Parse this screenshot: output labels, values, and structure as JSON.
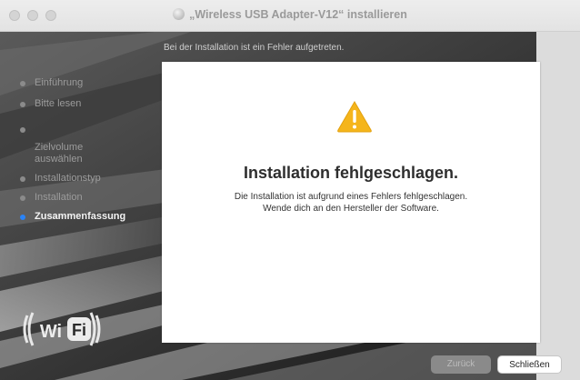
{
  "window": {
    "title": "„Wireless USB Adapter-V12“ installieren"
  },
  "header": {
    "message": "Bei der Installation ist ein Fehler aufgetreten."
  },
  "sidebar": {
    "steps": [
      {
        "label": "Einführung",
        "active": false
      },
      {
        "label": "Bitte lesen",
        "active": false
      },
      {
        "label": "Zielvolume\nauswählen",
        "active": false
      },
      {
        "label": "Installationstyp",
        "active": false
      },
      {
        "label": "Installation",
        "active": false
      },
      {
        "label": "Zusammenfassung",
        "active": true
      }
    ]
  },
  "logo": {
    "left": "Wi",
    "right": "Fi"
  },
  "panel": {
    "icon": "warning-icon",
    "headline": "Installation fehlgeschlagen.",
    "message_line1": "Die Installation ist aufgrund eines Fehlers fehlgeschlagen.",
    "message_line2": "Wende dich an den Hersteller der Software."
  },
  "buttons": {
    "back": "Zurück",
    "close": "Schließen"
  },
  "colors": {
    "accent": "#2a83f6",
    "warning": "#f5b51b"
  }
}
